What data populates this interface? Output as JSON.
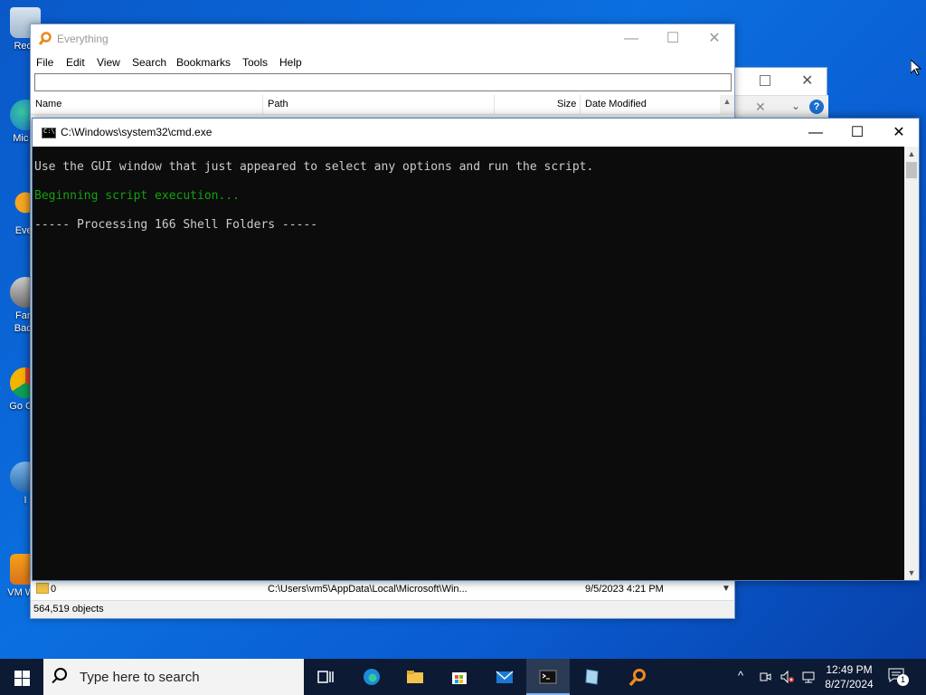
{
  "desktop": {
    "icons": [
      {
        "label": "Recy",
        "name": "recycle-bin"
      },
      {
        "label": "Mic E",
        "name": "microsoft-edge"
      },
      {
        "label": "Ever",
        "name": "everything"
      },
      {
        "label": "Fam Back",
        "name": "family-backup"
      },
      {
        "label": "Go Chr",
        "name": "google-chrome"
      },
      {
        "label": "I",
        "name": "shortcut-i"
      },
      {
        "label": "VM Wor",
        "name": "vmware-workstation"
      }
    ]
  },
  "everything": {
    "title": "Everything",
    "menu": [
      "File",
      "Edit",
      "View",
      "Search",
      "Bookmarks",
      "Tools",
      "Help"
    ],
    "search_value": "",
    "columns": [
      "Name",
      "Path",
      "Size",
      "Date Modified"
    ],
    "row": {
      "name": "0",
      "path": "C:\\Users\\vm5\\AppData\\Local\\Microsoft\\Win...",
      "date": "9/5/2023 4:21 PM"
    },
    "status": "564,519 objects",
    "controls": {
      "minimize": "—",
      "maximize": "☐",
      "close": "✕"
    }
  },
  "cmd": {
    "title": "C:\\Windows\\system32\\cmd.exe",
    "lines": [
      {
        "text": "Use the GUI window that just appeared to select any options and run the script.",
        "color": "#cccccc"
      },
      {
        "text": "Beginning script execution...",
        "color": "#13a10e"
      },
      {
        "text": "----- Processing 166 Shell Folders -----",
        "color": "#cccccc"
      }
    ],
    "controls": {
      "minimize": "—",
      "maximize": "☐",
      "close": "✕"
    }
  },
  "taskbar": {
    "search_placeholder": "Type here to search",
    "apps": [
      "task-view",
      "edge",
      "file-explorer",
      "store",
      "mail",
      "cmd",
      "notes",
      "everything"
    ],
    "active_app": "cmd",
    "time": "12:49 PM",
    "date": "8/27/2024",
    "notification_count": "1"
  }
}
